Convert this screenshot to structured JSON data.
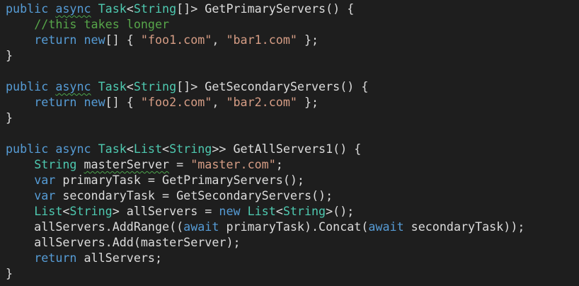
{
  "editor": {
    "theme": {
      "background": "#1e1e1e",
      "keyword": "#569cd6",
      "type": "#4ec9b0",
      "plain": "#dcdcdc",
      "string": "#d69d85",
      "comment": "#57a64a",
      "squiggle": "#4ca64c"
    },
    "lines": [
      [
        [
          "keyword",
          "public"
        ],
        [
          "plain",
          " "
        ],
        [
          "keyword",
          "async",
          "sq"
        ],
        [
          "plain",
          " "
        ],
        [
          "type",
          "Task"
        ],
        [
          "plain",
          "<"
        ],
        [
          "type",
          "String"
        ],
        [
          "plain",
          "[]> GetPrimaryServers() {"
        ]
      ],
      [
        [
          "plain",
          "    "
        ],
        [
          "comment",
          "//this takes longer"
        ]
      ],
      [
        [
          "plain",
          "    "
        ],
        [
          "keyword",
          "return"
        ],
        [
          "plain",
          " "
        ],
        [
          "keyword",
          "new"
        ],
        [
          "plain",
          "[] { "
        ],
        [
          "string",
          "\"foo1.com\""
        ],
        [
          "plain",
          ", "
        ],
        [
          "string",
          "\"bar1.com\""
        ],
        [
          "plain",
          " };"
        ]
      ],
      [
        [
          "plain",
          "}"
        ]
      ],
      [],
      [
        [
          "keyword",
          "public"
        ],
        [
          "plain",
          " "
        ],
        [
          "keyword",
          "async",
          "sq"
        ],
        [
          "plain",
          " "
        ],
        [
          "type",
          "Task"
        ],
        [
          "plain",
          "<"
        ],
        [
          "type",
          "String"
        ],
        [
          "plain",
          "[]> GetSecondaryServers() {"
        ]
      ],
      [
        [
          "plain",
          "    "
        ],
        [
          "keyword",
          "return"
        ],
        [
          "plain",
          " "
        ],
        [
          "keyword",
          "new"
        ],
        [
          "plain",
          "[] { "
        ],
        [
          "string",
          "\"foo2.com\""
        ],
        [
          "plain",
          ", "
        ],
        [
          "string",
          "\"bar2.com\""
        ],
        [
          "plain",
          " };"
        ]
      ],
      [
        [
          "plain",
          "}"
        ]
      ],
      [],
      [
        [
          "keyword",
          "public"
        ],
        [
          "plain",
          " "
        ],
        [
          "keyword",
          "async"
        ],
        [
          "plain",
          " "
        ],
        [
          "type",
          "Task"
        ],
        [
          "plain",
          "<"
        ],
        [
          "type",
          "List"
        ],
        [
          "plain",
          "<"
        ],
        [
          "type",
          "String"
        ],
        [
          "plain",
          ">> GetAllServers1() {"
        ]
      ],
      [
        [
          "plain",
          "    "
        ],
        [
          "type",
          "String"
        ],
        [
          "plain",
          " "
        ],
        [
          "plain",
          "masterServer",
          "sq"
        ],
        [
          "plain",
          " = "
        ],
        [
          "string",
          "\"master.com\""
        ],
        [
          "plain",
          ";"
        ]
      ],
      [
        [
          "plain",
          "    "
        ],
        [
          "keyword",
          "var"
        ],
        [
          "plain",
          " primaryTask = GetPrimaryServers();"
        ]
      ],
      [
        [
          "plain",
          "    "
        ],
        [
          "keyword",
          "var"
        ],
        [
          "plain",
          " secondaryTask = GetSecondaryServers();"
        ]
      ],
      [
        [
          "plain",
          "    "
        ],
        [
          "type",
          "List"
        ],
        [
          "plain",
          "<"
        ],
        [
          "type",
          "String"
        ],
        [
          "plain",
          "> allServers = "
        ],
        [
          "keyword",
          "new"
        ],
        [
          "plain",
          " "
        ],
        [
          "type",
          "List"
        ],
        [
          "plain",
          "<"
        ],
        [
          "type",
          "String"
        ],
        [
          "plain",
          ">();"
        ]
      ],
      [
        [
          "plain",
          "    allServers.AddRange(("
        ],
        [
          "keyword",
          "await"
        ],
        [
          "plain",
          " primaryTask).Concat("
        ],
        [
          "keyword",
          "await"
        ],
        [
          "plain",
          " secondaryTask));"
        ]
      ],
      [
        [
          "plain",
          "    allServers.Add(masterServer);"
        ]
      ],
      [
        [
          "plain",
          "    "
        ],
        [
          "keyword",
          "return"
        ],
        [
          "plain",
          " allServers;"
        ]
      ],
      [
        [
          "plain",
          "}"
        ]
      ]
    ]
  }
}
